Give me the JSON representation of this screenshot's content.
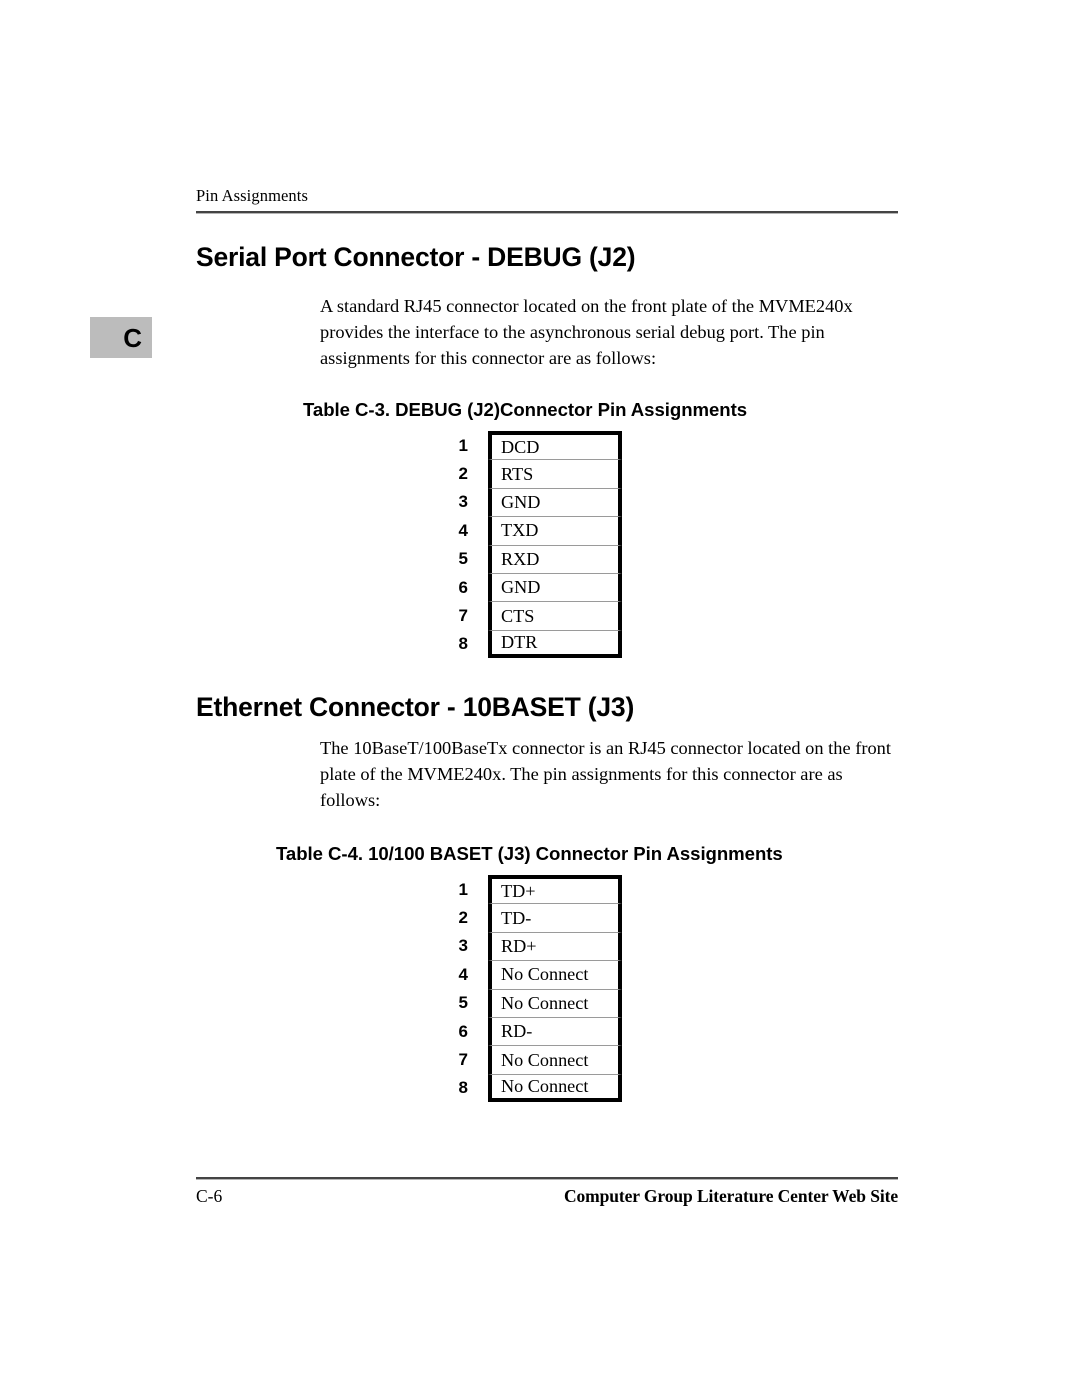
{
  "header": {
    "running_title": "Pin Assignments"
  },
  "chapter_tab": {
    "letter": "C"
  },
  "sections": [
    {
      "heading": "Serial Port Connector - DEBUG (J2)",
      "paragraph": "A standard RJ45 connector located on the front plate of the MVME240x provides the interface to the asynchronous serial debug port. The pin assignments for this connector are as follows:"
    },
    {
      "heading": "Ethernet Connector - 10BASET (J3)",
      "paragraph": "The 10BaseT/100BaseTx connector is an RJ45 connector located on the front plate of the MVME240x. The pin assignments for this connector are as follows:"
    }
  ],
  "tables": [
    {
      "caption": "Table C-3.  DEBUG (J2)Connector Pin Assignments",
      "rows": [
        {
          "pin": "1",
          "signal": "DCD"
        },
        {
          "pin": "2",
          "signal": "RTS"
        },
        {
          "pin": "3",
          "signal": "GND"
        },
        {
          "pin": "4",
          "signal": "TXD"
        },
        {
          "pin": "5",
          "signal": "RXD"
        },
        {
          "pin": "6",
          "signal": "GND"
        },
        {
          "pin": "7",
          "signal": "CTS"
        },
        {
          "pin": "8",
          "signal": "DTR"
        }
      ]
    },
    {
      "caption": "Table C-4.  10/100 BASET (J3) Connector Pin Assignments",
      "rows": [
        {
          "pin": "1",
          "signal": "TD+"
        },
        {
          "pin": "2",
          "signal": "TD-"
        },
        {
          "pin": "3",
          "signal": "RD+"
        },
        {
          "pin": "4",
          "signal": "No Connect"
        },
        {
          "pin": "5",
          "signal": "No Connect"
        },
        {
          "pin": "6",
          "signal": "RD-"
        },
        {
          "pin": "7",
          "signal": "No Connect"
        },
        {
          "pin": "8",
          "signal": "No Connect"
        }
      ]
    }
  ],
  "footer": {
    "page_number": "C-6",
    "note": "Computer Group Literature Center Web Site"
  }
}
